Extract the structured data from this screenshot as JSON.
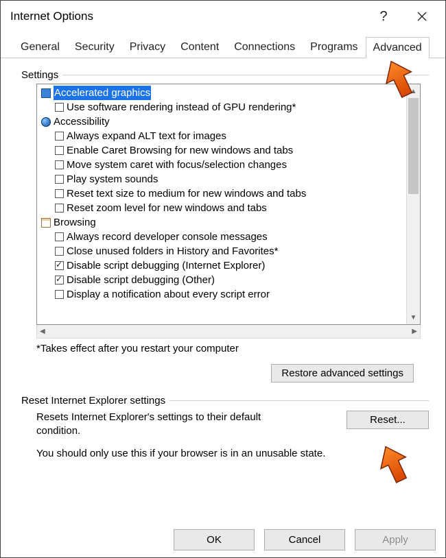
{
  "window": {
    "title": "Internet Options"
  },
  "tabs": {
    "general": "General",
    "security": "Security",
    "privacy": "Privacy",
    "content": "Content",
    "connections": "Connections",
    "programs": "Programs",
    "advanced": "Advanced"
  },
  "settings": {
    "label": "Settings",
    "cat_accel": "Accelerated graphics",
    "accel_sw": "Use software rendering instead of GPU rendering*",
    "cat_access": "Accessibility",
    "acc_alt": "Always expand ALT text for images",
    "acc_caret": "Enable Caret Browsing for new windows and tabs",
    "acc_move": "Move system caret with focus/selection changes",
    "acc_sounds": "Play system sounds",
    "acc_text": "Reset text size to medium for new windows and tabs",
    "acc_zoom": "Reset zoom level for new windows and tabs",
    "cat_browse": "Browsing",
    "br_console": "Always record developer console messages",
    "br_close": "Close unused folders in History and Favorites*",
    "br_dbg_ie": "Disable script debugging (Internet Explorer)",
    "br_dbg_other": "Disable script debugging (Other)",
    "br_notify": "Display a notification about every script error",
    "note": "*Takes effect after you restart your computer",
    "restore_btn": "Restore advanced settings"
  },
  "reset": {
    "label": "Reset Internet Explorer settings",
    "desc": "Resets Internet Explorer's settings to their default condition.",
    "note": "You should only use this if your browser is in an unusable state.",
    "btn": "Reset..."
  },
  "footer": {
    "ok": "OK",
    "cancel": "Cancel",
    "apply": "Apply"
  }
}
